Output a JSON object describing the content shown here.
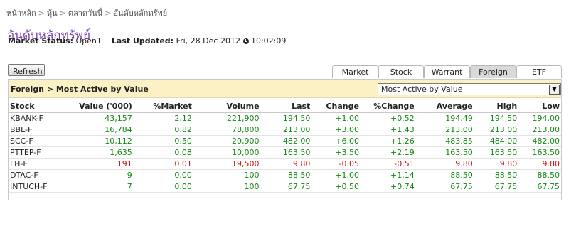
{
  "breadcrumb": [
    "หน้าหลัก",
    "หุ้น",
    "ตลาดวันนี้",
    "อันดับหลักทรัพย์"
  ],
  "page_title": "อันดับหลักทรัพย์",
  "status": {
    "market_status_label": "Market Status:",
    "market_status_value": "Open1",
    "last_updated_label": "Last Updated:",
    "last_updated_value": "Fri, 28 Dec 2012",
    "time": "10:02:09"
  },
  "refresh_label": "Refresh",
  "tabs": [
    "Market",
    "Stock",
    "Warrant",
    "Foreign",
    "ETF"
  ],
  "active_tab": "Foreign",
  "panel_title": "Foreign > Most Active by Value",
  "select_value": "Most Active by Value",
  "columns": [
    "Stock",
    "Value ('000)",
    "%Market",
    "Volume",
    "Last",
    "Change",
    "%Change",
    "Average",
    "High",
    "Low"
  ],
  "rows": [
    {
      "trend": "up",
      "cells": [
        "KBANK-F",
        "43,157",
        "2.12",
        "221,900",
        "194.50",
        "+1.00",
        "+0.52",
        "194.49",
        "194.50",
        "194.00"
      ]
    },
    {
      "trend": "up",
      "cells": [
        "BBL-F",
        "16,784",
        "0.82",
        "78,800",
        "213.00",
        "+3.00",
        "+1.43",
        "213.00",
        "213.00",
        "213.00"
      ]
    },
    {
      "trend": "up",
      "cells": [
        "SCC-F",
        "10,112",
        "0.50",
        "20,900",
        "482.00",
        "+6.00",
        "+1.26",
        "483.85",
        "484.00",
        "482.00"
      ]
    },
    {
      "trend": "up",
      "cells": [
        "PTTEP-F",
        "1,635",
        "0.08",
        "10,000",
        "163.50",
        "+3.50",
        "+2.19",
        "163.50",
        "163.50",
        "163.50"
      ]
    },
    {
      "trend": "down",
      "cells": [
        "LH-F",
        "191",
        "0.01",
        "19,500",
        "9.80",
        "-0.05",
        "-0.51",
        "9.80",
        "9.80",
        "9.80"
      ]
    },
    {
      "trend": "up",
      "cells": [
        "DTAC-F",
        "9",
        "0.00",
        "100",
        "88.50",
        "+1.00",
        "+1.14",
        "88.50",
        "88.50",
        "88.50"
      ]
    },
    {
      "trend": "up",
      "cells": [
        "INTUCH-F",
        "7",
        "0.00",
        "100",
        "67.75",
        "+0.50",
        "+0.74",
        "67.75",
        "67.75",
        "67.75"
      ]
    }
  ],
  "colors": {
    "up": "#118811",
    "down": "#cc1111",
    "title": "#7a3bb0",
    "header_bg": "#fbf1c4"
  }
}
